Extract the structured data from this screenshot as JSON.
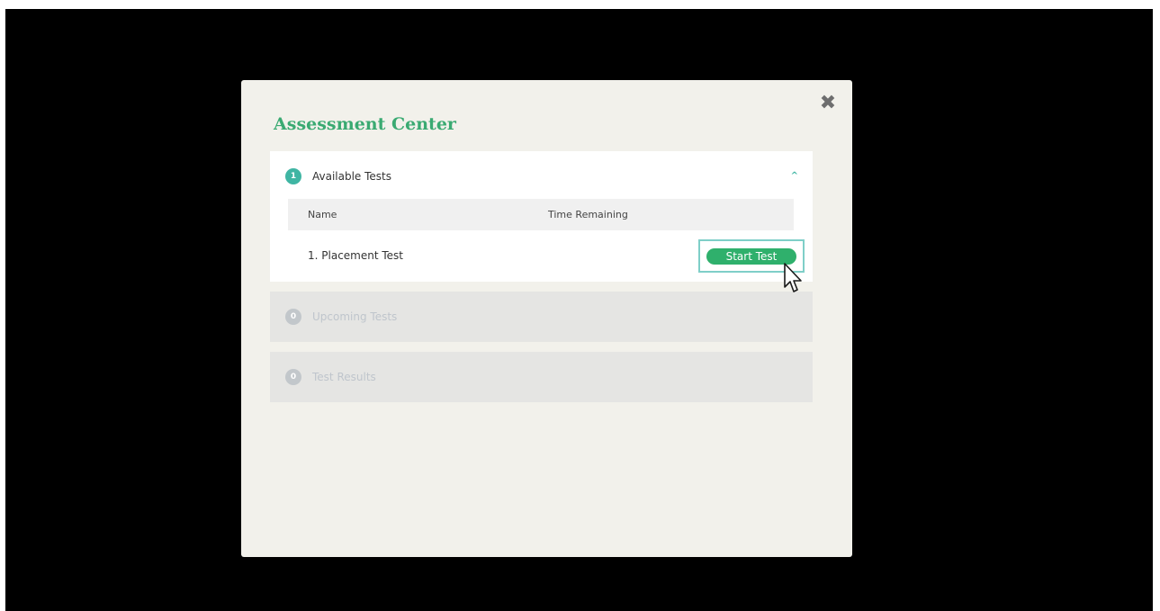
{
  "modal": {
    "title": "Assessment Center",
    "close_icon": "close-icon",
    "close_glyph": "✖"
  },
  "sections": [
    {
      "badge": "1",
      "label": "Available Tests",
      "expanded": true,
      "chevron": "^",
      "columns": [
        "Name",
        "Time Remaining"
      ],
      "rows": [
        {
          "name": "1. Placement Test",
          "time_remaining": "",
          "action": "Start Test"
        }
      ]
    },
    {
      "badge": "0",
      "label": "Upcoming Tests",
      "expanded": false
    },
    {
      "badge": "0",
      "label": "Test Results",
      "expanded": false
    }
  ],
  "colors": {
    "title_green": "#3aaa72",
    "badge_teal": "#3fb5a3",
    "button_green": "#2fb06c",
    "modal_bg": "#f2f1eb",
    "backdrop": "#000000"
  }
}
